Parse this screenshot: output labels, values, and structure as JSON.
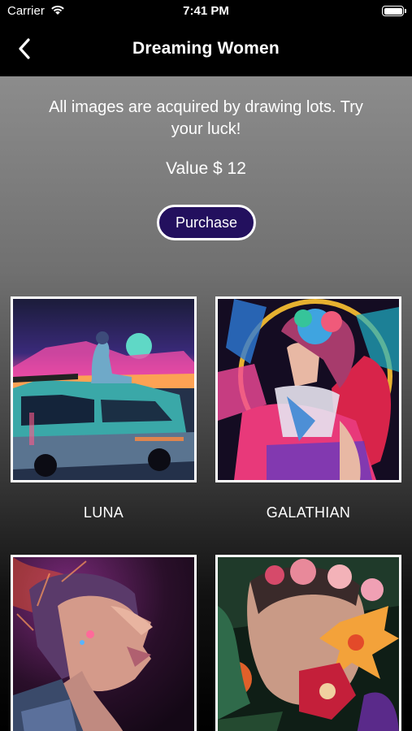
{
  "status": {
    "carrier": "Carrier",
    "time": "7:41 PM"
  },
  "nav": {
    "title": "Dreaming Women"
  },
  "intro": "All images are acquired by drawing lots. Try your luck!",
  "value": "Value $ 12",
  "purchase_label": "Purchase",
  "cards": [
    {
      "label": "LUNA"
    },
    {
      "label": "GALATHIAN"
    },
    {
      "label": ""
    },
    {
      "label": ""
    }
  ]
}
